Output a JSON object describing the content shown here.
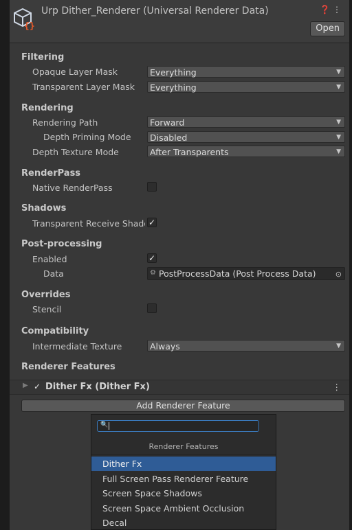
{
  "header": {
    "title": "Urp Dither_Renderer (Universal Renderer Data)",
    "help_icon": "help-icon",
    "menu_icon": "kebab-menu-icon",
    "open_label": "Open"
  },
  "filtering": {
    "section": "Filtering",
    "opaque_label": "Opaque Layer Mask",
    "opaque_value": "Everything",
    "transparent_label": "Transparent Layer Mask",
    "transparent_value": "Everything"
  },
  "rendering": {
    "section": "Rendering",
    "path_label": "Rendering Path",
    "path_value": "Forward",
    "priming_label": "Depth Priming Mode",
    "priming_value": "Disabled",
    "depth_label": "Depth Texture Mode",
    "depth_value": "After Transparents"
  },
  "renderpass": {
    "section": "RenderPass",
    "native_label": "Native RenderPass",
    "native_checked": false
  },
  "shadows": {
    "section": "Shadows",
    "receive_label": "Transparent Receive Shadows",
    "receive_checked": true
  },
  "postprocessing": {
    "section": "Post-processing",
    "enabled_label": "Enabled",
    "enabled_checked": true,
    "data_label": "Data",
    "data_value": "PostProcessData (Post Process Data)"
  },
  "overrides": {
    "section": "Overrides",
    "stencil_label": "Stencil",
    "stencil_checked": false
  },
  "compatibility": {
    "section": "Compatibility",
    "intermediate_label": "Intermediate Texture",
    "intermediate_value": "Always"
  },
  "features": {
    "section": "Renderer Features",
    "items": [
      {
        "name": "Dither Fx (Dither Fx)",
        "enabled": true
      }
    ],
    "add_label": "Add Renderer Feature"
  },
  "popup": {
    "search_value": "",
    "heading": "Renderer Features",
    "items": [
      {
        "label": "Dither Fx",
        "selected": true
      },
      {
        "label": "Full Screen Pass Renderer Feature",
        "selected": false
      },
      {
        "label": "Screen Space Shadows",
        "selected": false
      },
      {
        "label": "Screen Space Ambient Occlusion",
        "selected": false
      },
      {
        "label": "Decal",
        "selected": false
      }
    ]
  },
  "colors": {
    "accent": "#2f5c96",
    "focus": "#3a79bb"
  }
}
